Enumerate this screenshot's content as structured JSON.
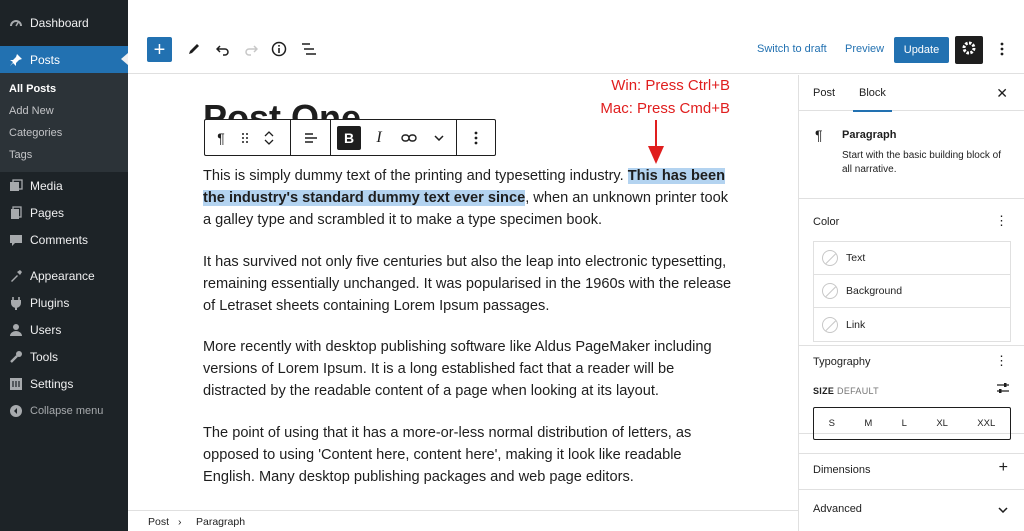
{
  "sidebar": {
    "items": [
      {
        "label": "Dashboard",
        "icon": "dashboard-icon"
      },
      {
        "label": "Posts",
        "icon": "pushpin-icon"
      },
      {
        "label": "Media",
        "icon": "media-icon"
      },
      {
        "label": "Pages",
        "icon": "pages-icon"
      },
      {
        "label": "Comments",
        "icon": "comments-icon"
      },
      {
        "label": "Appearance",
        "icon": "appearance-icon"
      },
      {
        "label": "Plugins",
        "icon": "plugins-icon"
      },
      {
        "label": "Users",
        "icon": "users-icon"
      },
      {
        "label": "Tools",
        "icon": "tools-icon"
      },
      {
        "label": "Settings",
        "icon": "settings-icon"
      }
    ],
    "submenu": [
      "All Posts",
      "Add New",
      "Categories",
      "Tags"
    ],
    "collapse_label": "Collapse menu"
  },
  "toolbar": {
    "switch_draft": "Switch to draft",
    "preview": "Preview",
    "update": "Update"
  },
  "editor": {
    "title": "Post One",
    "p1_before": "This is simply dummy text of the printing and typesetting industry. ",
    "p1_selected": "This has been the industry's standard dummy text ever since",
    "p1_after": ", when an unknown printer took a galley type and scrambled it to make a type specimen book.",
    "p2": "It has survived not only five centuries but also the leap into electronic typesetting, remaining essentially unchanged. It was popularised in the 1960s with the release of Letraset sheets containing Lorem Ipsum passages.",
    "p3": "More recently with desktop publishing software like Aldus PageMaker including versions of Lorem Ipsum. It is a long established fact that a reader will be distracted by the readable content of a page when looking at its layout.",
    "p4": "The point of using that it has a more-or-less normal distribution of letters, as opposed to using 'Content here, content here', making it look like readable English. Many desktop publishing packages and web page editors."
  },
  "block_toolbar": {
    "bold": "B",
    "italic": "I"
  },
  "annotation": {
    "line1": "Win: Press Ctrl+B",
    "line2": "Mac: Press Cmd+B",
    "color": "#e01e1e"
  },
  "settings": {
    "tab_post": "Post",
    "tab_block": "Block",
    "block_name": "Paragraph",
    "block_desc": "Start with the basic building block of all narrative.",
    "color_title": "Color",
    "colors": [
      "Text",
      "Background",
      "Link"
    ],
    "typography_title": "Typography",
    "size_label": "SIZE",
    "size_value": "DEFAULT",
    "sizes": [
      "S",
      "M",
      "L",
      "XL",
      "XXL"
    ],
    "dimensions_title": "Dimensions",
    "advanced_title": "Advanced"
  },
  "breadcrumb": {
    "items": [
      "Post",
      "Paragraph"
    ]
  },
  "colors": {
    "accent": "#2271b1",
    "sidebar_bg": "#1d2327",
    "selection": "#b3d3f0"
  }
}
